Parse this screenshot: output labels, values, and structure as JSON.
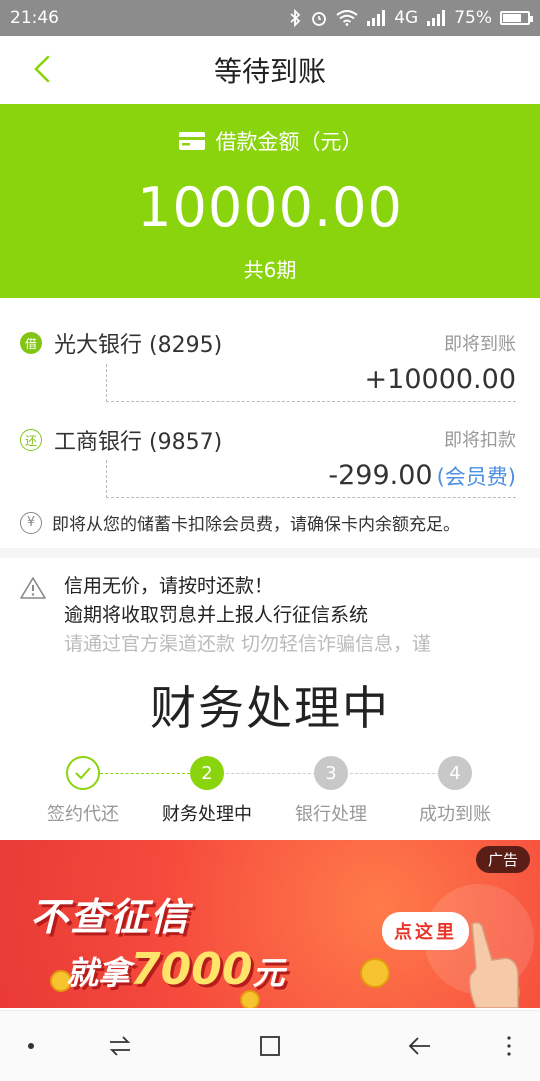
{
  "status_bar": {
    "time": "21:46",
    "network": "4G",
    "battery": "75%",
    "battery_level": 0.75
  },
  "header": {
    "title": "等待到账"
  },
  "banner": {
    "label": "借款金额（元）",
    "amount": "10000.00",
    "periods": "共6期"
  },
  "banks": [
    {
      "tag": "借",
      "name": "光大银行 (8295)",
      "status": "即将到账",
      "amount": "+10000.00"
    },
    {
      "tag": "还",
      "name": "工商银行 (9857)",
      "status": "即将扣款",
      "amount": "-299.00",
      "fee_note": "(会员费)"
    }
  ],
  "notice": {
    "icon_char": "¥",
    "text": "即将从您的储蓄卡扣除会员费，请确保卡内余额充足。"
  },
  "warning": {
    "line1": "信用无价，请按时还款！",
    "line2": "逾期将收取罚息并上报人行征信系统",
    "line3": "请通过官方渠道还款 切勿轻信诈骗信息，谨"
  },
  "processing_title": "财务处理中",
  "steps": [
    {
      "label": "签约代还",
      "state": "done",
      "num": ""
    },
    {
      "label": "财务处理中",
      "state": "active",
      "num": "2"
    },
    {
      "label": "银行处理",
      "state": "pending",
      "num": "3"
    },
    {
      "label": "成功到账",
      "state": "pending",
      "num": "4"
    }
  ],
  "ad": {
    "tag": "广告",
    "line1": "不查征信",
    "line2_prefix": "就拿",
    "line2_amount": "7000",
    "line2_suffix": "元",
    "button": "点这里"
  },
  "colors": {
    "accent": "#8ad40e",
    "fee_blue": "#4d8fe0",
    "ad_red": "#f54a3c"
  }
}
